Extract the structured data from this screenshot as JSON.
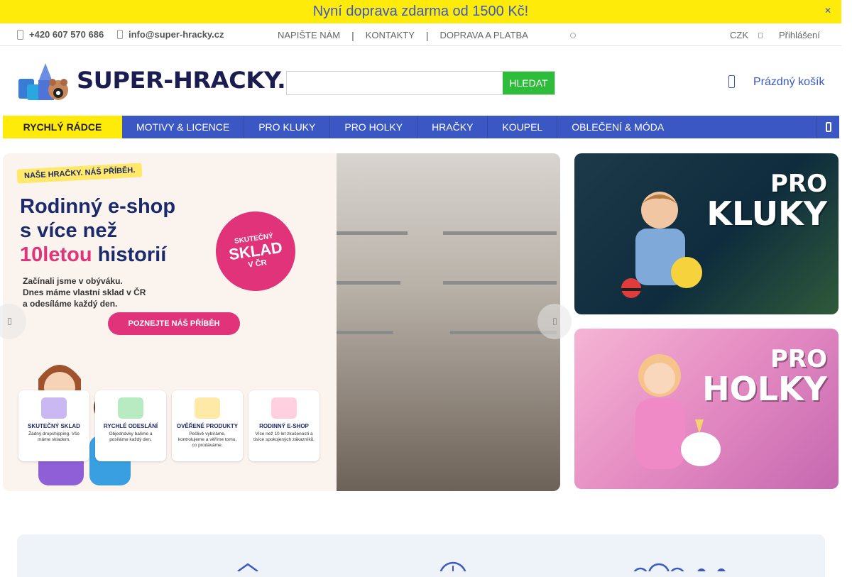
{
  "promo": {
    "text": "Nyní doprava zdarma od 1500 Kč!",
    "close_icon": "close-icon"
  },
  "topbar": {
    "phone": "+420 607 570 686",
    "email": "info@super-hracky.cz",
    "links": [
      "NAPIŠTE NÁM",
      "KONTAKTY",
      "DOPRAVA A PLATBA"
    ],
    "currency": "CZK",
    "login": "Přihlášení"
  },
  "header": {
    "logo_text": "SUPER-HRACKY.CZ",
    "search_placeholder": "",
    "search_button": "HLEDAT",
    "cart_label": "Prázdný košík"
  },
  "nav": {
    "fast": "RYCHLÝ RÁDCE",
    "items": [
      "MOTIVY & LICENCE",
      "PRO KLUKY",
      "PRO HOLKY",
      "HRAČKY",
      "KOUPEL",
      "OBLEČENÍ & MÓDA"
    ]
  },
  "hero": {
    "tag": "NAŠE HRAČKY. NÁŠ PŘÍBĚH.",
    "headline_1": "Rodinný e-shop",
    "headline_2": "s více než",
    "headline_3a": "10letou",
    "headline_3b": "historií",
    "subtext_1": "Začínali jsme v obýváku.",
    "subtext_2": "Dnes máme vlastní sklad v ČR",
    "subtext_3": "a odesíláme každý den.",
    "badge_1": "SKUTEČNÝ",
    "badge_2": "SKLAD",
    "badge_3": "V ČR",
    "cta": "POZNEJTE NÁŠ PŘÍBĚH",
    "cards": [
      {
        "title": "SKUTEČNÝ SKLAD",
        "desc": "Žádný dropshipping. Vše máme skladem.",
        "color": "#c9b8f2"
      },
      {
        "title": "RYCHLÉ ODESLÁNÍ",
        "desc": "Objednávky balíme a posíláme každý den.",
        "color": "#b9ebc3"
      },
      {
        "title": "OVĚŘENÉ PRODUKTY",
        "desc": "Pečlivě vybíráme, kontrolujeme a věříme tomu, co prodáváme.",
        "color": "#ffe9a6"
      },
      {
        "title": "RODINNÝ E-SHOP",
        "desc": "Více než 10 let zkušeností a tisíce spokojených zákazníků.",
        "color": "#ffd0e0"
      }
    ]
  },
  "promo_cards": {
    "boys": {
      "line1": "PRO",
      "line2": "KLUKY"
    },
    "girls": {
      "line1": "PRO",
      "line2": "HOLKY"
    }
  },
  "colors": {
    "accent": "#3a57c4",
    "promo": "#ffeb0a",
    "search": "#2ebd3b",
    "pink": "#e0337a"
  }
}
